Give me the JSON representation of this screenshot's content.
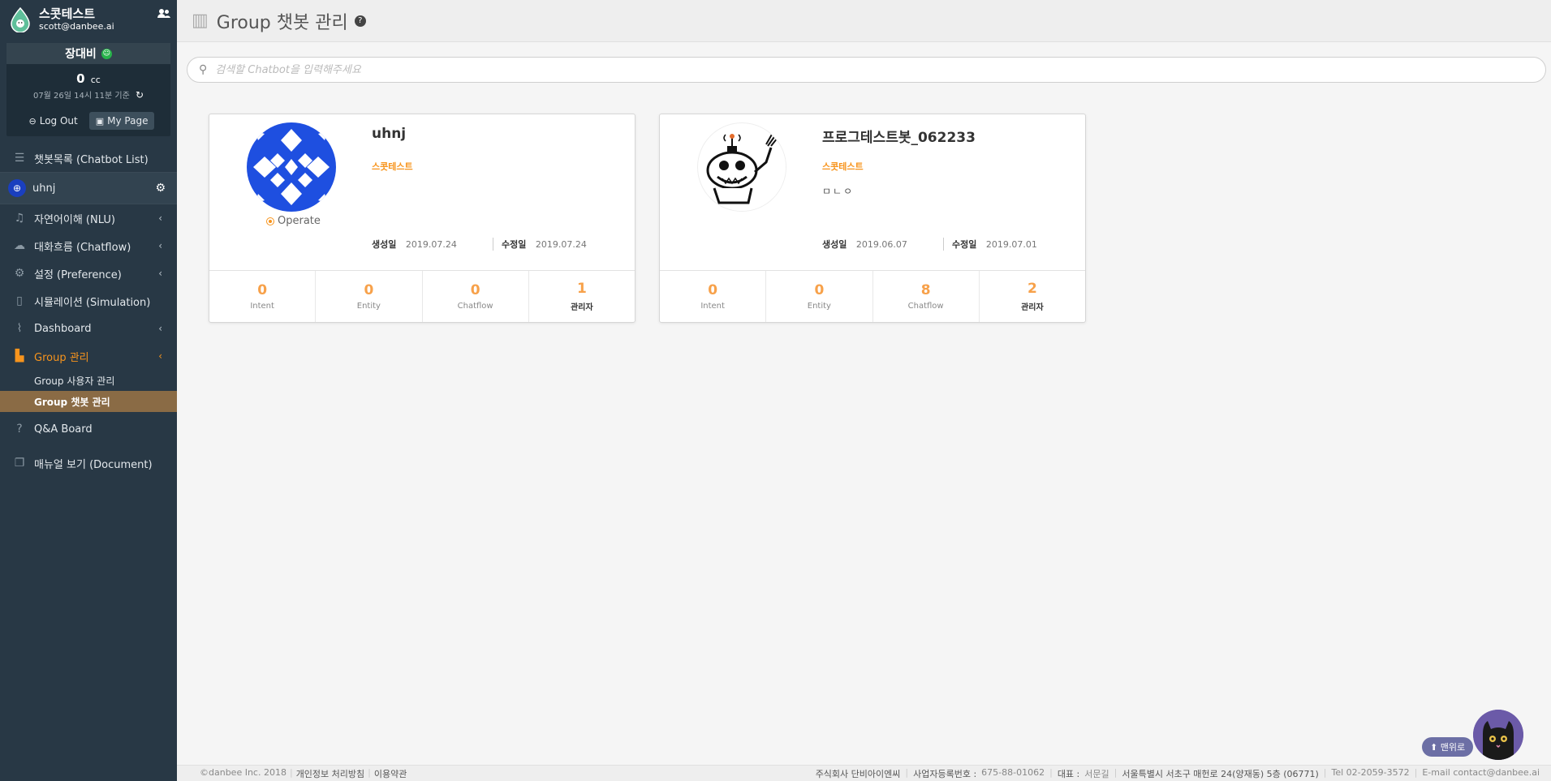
{
  "brand": {
    "name": "스콧테스트",
    "email": "scott@danbee.ai"
  },
  "user": {
    "name": "장대비"
  },
  "credit": {
    "value": "0",
    "unit": "cc",
    "updated": "07월 26일 14시 11분 기준"
  },
  "account": {
    "logout_label": "Log Out",
    "mypage_label": "My Page"
  },
  "nav": {
    "chatbot_list": "챗봇목록 (Chatbot List)",
    "current_bot": "uhnj",
    "nlu": "자연어이해 (NLU)",
    "chatflow": "대화흐름 (Chatflow)",
    "preference": "설정 (Preference)",
    "simulation": "시뮬레이션 (Simulation)",
    "dashboard": "Dashboard",
    "group": "Group 관리",
    "group_users": "Group 사용자 관리",
    "group_bots": "Group 챗봇 관리",
    "qa": "Q&A Board",
    "manual": "매뉴얼 보기 (Document)"
  },
  "header": {
    "title": "Group 챗봇 관리"
  },
  "search": {
    "placeholder": "검색할 Chatbot을 입력해주세요"
  },
  "cards": [
    {
      "name": "uhnj",
      "group": "스콧테스트",
      "description": "",
      "status": "Operate",
      "created_label": "생성일",
      "created": "2019.07.24",
      "modified_label": "수정일",
      "modified": "2019.07.24",
      "stats": [
        {
          "value": "0",
          "label": "Intent"
        },
        {
          "value": "0",
          "label": "Entity"
        },
        {
          "value": "0",
          "label": "Chatflow"
        },
        {
          "value": "1",
          "label": "관리자"
        }
      ]
    },
    {
      "name": "프로그테스트봇_062233",
      "group": "스콧테스트",
      "description": "ㅁㄴㅇ",
      "created_label": "생성일",
      "created": "2019.06.07",
      "modified_label": "수정일",
      "modified": "2019.07.01",
      "stats": [
        {
          "value": "0",
          "label": "Intent"
        },
        {
          "value": "0",
          "label": "Entity"
        },
        {
          "value": "8",
          "label": "Chatflow"
        },
        {
          "value": "2",
          "label": "관리자"
        }
      ]
    }
  ],
  "footer": {
    "copyright": "©danbee Inc. 2018",
    "privacy": "개인정보 처리방침",
    "terms": "이용약관",
    "company": "주식회사 단비아이엔씨",
    "biz_label": "사업자등록번호 :",
    "biz_number": "675-88-01062",
    "ceo_label": "대표 :",
    "ceo": "서문길",
    "address": "서울특별시 서초구 매헌로 24(양재동) 5층 (06771)",
    "tel": "Tel 02-2059-3572",
    "email": "E-mail contact@danbee.ai"
  },
  "floating": {
    "top_label": "⬆ 맨위로"
  },
  "colors": {
    "sidebar_bg": "#283845",
    "accent": "#f7941d",
    "active_submenu": "#8a6b45",
    "stat_number": "#f7a14a"
  }
}
